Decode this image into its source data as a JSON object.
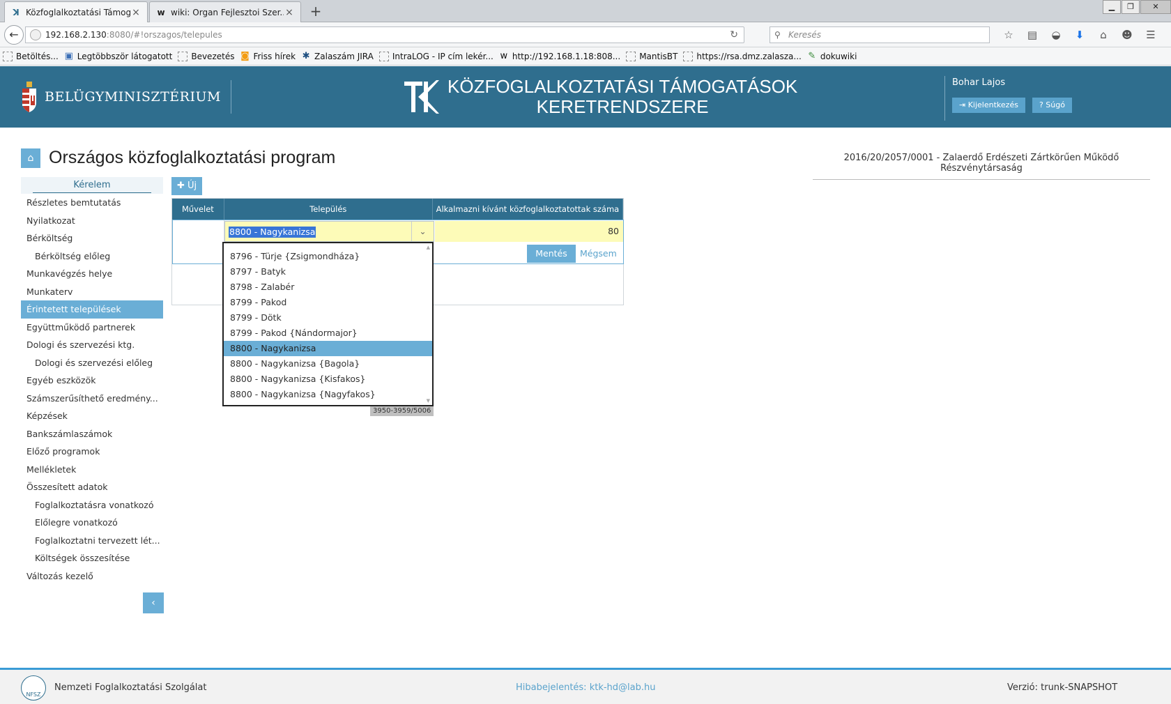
{
  "browser": {
    "tabs": [
      {
        "title": "Közfoglalkoztatási Támog...",
        "active": true,
        "icon": "ktk-logo-icon"
      },
      {
        "title": "wiki: Organ Fejlesztoi Szer...",
        "active": false,
        "icon": "wiki-icon"
      }
    ],
    "new_tab": "+",
    "window_buttons": {
      "minimize": "▁",
      "restore": "❐",
      "close": "✕"
    },
    "url_host": "192.168.2.130",
    "url_rest": ":8080/#!orszagos/telepules",
    "search_placeholder": "Keresés",
    "bookmarks": [
      {
        "label": "Betöltés...",
        "icon": "page-icon"
      },
      {
        "label": "Legtöbbször látogatott",
        "icon": "star-folder-icon"
      },
      {
        "label": "Bevezetés",
        "icon": "page-icon"
      },
      {
        "label": "Friss hírek",
        "icon": "rss-icon"
      },
      {
        "label": "Zalaszám JIRA",
        "icon": "jira-icon"
      },
      {
        "label": "IntraLOG - IP cím lekér...",
        "icon": "page-icon"
      },
      {
        "label": "http://192.168.1.18:808...",
        "icon": "wiki-icon"
      },
      {
        "label": "MantisBT",
        "icon": "page-icon"
      },
      {
        "label": "https://rsa.dmz.zalasza...",
        "icon": "page-icon"
      },
      {
        "label": "dokuwiki",
        "icon": "dokuwiki-icon"
      }
    ]
  },
  "header": {
    "ministry": "BELÜGYMINISZTÉRIUM",
    "brand_line1": "KÖZFOGLALKOZTATÁSI TÁMOGATÁSOK",
    "brand_line2": "KERETRENDSZERE",
    "user": "Bohar Lajos",
    "logout": "Kijelentkezés",
    "help": "Súgó"
  },
  "page": {
    "title": "Országos közfoglalkoztatási program",
    "context": "2016/20/2057/0001 - Zalaerdő Erdészeti Zártkörűen Működő Részvénytársaság"
  },
  "sidebar": {
    "heading": "Kérelem",
    "items": [
      {
        "label": "Részletes bemtutatás",
        "sub": false,
        "active": false
      },
      {
        "label": "Nyilatkozat",
        "sub": false,
        "active": false
      },
      {
        "label": "Bérköltség",
        "sub": false,
        "active": false
      },
      {
        "label": "Bérköltség előleg",
        "sub": true,
        "active": false
      },
      {
        "label": "Munkavégzés helye",
        "sub": false,
        "active": false
      },
      {
        "label": "Munkaterv",
        "sub": false,
        "active": false
      },
      {
        "label": "Érintetett települések",
        "sub": false,
        "active": true
      },
      {
        "label": "Együttműködő partnerek",
        "sub": false,
        "active": false
      },
      {
        "label": "Dologi és szervezési ktg.",
        "sub": false,
        "active": false
      },
      {
        "label": "Dologi és szervezési előleg",
        "sub": true,
        "active": false
      },
      {
        "label": "Egyéb eszközök",
        "sub": false,
        "active": false
      },
      {
        "label": "Számszerűsíthető eredmény...",
        "sub": false,
        "active": false
      },
      {
        "label": "Képzések",
        "sub": false,
        "active": false
      },
      {
        "label": "Bankszámlaszámok",
        "sub": false,
        "active": false
      },
      {
        "label": "Előző programok",
        "sub": false,
        "active": false
      },
      {
        "label": "Mellékletek",
        "sub": false,
        "active": false
      },
      {
        "label": "Összesített adatok",
        "sub": false,
        "active": false
      },
      {
        "label": "Foglalkoztatásra vonatkozó",
        "sub": true,
        "active": false
      },
      {
        "label": "Előlegre vonatkozó",
        "sub": true,
        "active": false
      },
      {
        "label": "Foglalkoztatni tervezett lét...",
        "sub": true,
        "active": false
      },
      {
        "label": "Költségek összesítése",
        "sub": true,
        "active": false
      },
      {
        "label": "Változás kezelő",
        "sub": false,
        "active": false
      }
    ],
    "collapse": "‹"
  },
  "grid": {
    "new_button": "Új",
    "columns": [
      "Művelet",
      "Település",
      "Alkalmazni kívánt közfoglalkoztatottak száma (fő)"
    ],
    "edit_row": {
      "settlement": "8800 - Nagykanizsa",
      "count": "80"
    },
    "save": "Mentés",
    "cancel": "Mégsem"
  },
  "dropdown": {
    "options": [
      {
        "label": "8796 - Türje {Zsigmondháza}",
        "selected": false
      },
      {
        "label": "8797 - Batyk",
        "selected": false
      },
      {
        "label": "8798 - Zalabér",
        "selected": false
      },
      {
        "label": "8799 - Pakod",
        "selected": false
      },
      {
        "label": "8799 - Dötk",
        "selected": false
      },
      {
        "label": "8799 - Pakod {Nándormajor}",
        "selected": false
      },
      {
        "label": "8800 - Nagykanizsa",
        "selected": true
      },
      {
        "label": "8800 - Nagykanizsa {Bagola}",
        "selected": false
      },
      {
        "label": "8800 - Nagykanizsa {Kisfakos}",
        "selected": false
      },
      {
        "label": "8800 - Nagykanizsa {Nagyfakos}",
        "selected": false
      }
    ],
    "counter": "3950-3959/5006"
  },
  "footer": {
    "org": "Nemzeti Foglalkoztatási Szolgálat",
    "logo_text": "NFSZ",
    "bug_report": "Hibabejelentés: ktk-hd@lab.hu",
    "version": "Verzió: trunk-SNAPSHOT"
  },
  "colors": {
    "header_bg": "#2f6e8e",
    "accent": "#6aaed6",
    "edit_yellow": "#fdfbb8",
    "footer_line": "#3a9bd5"
  }
}
